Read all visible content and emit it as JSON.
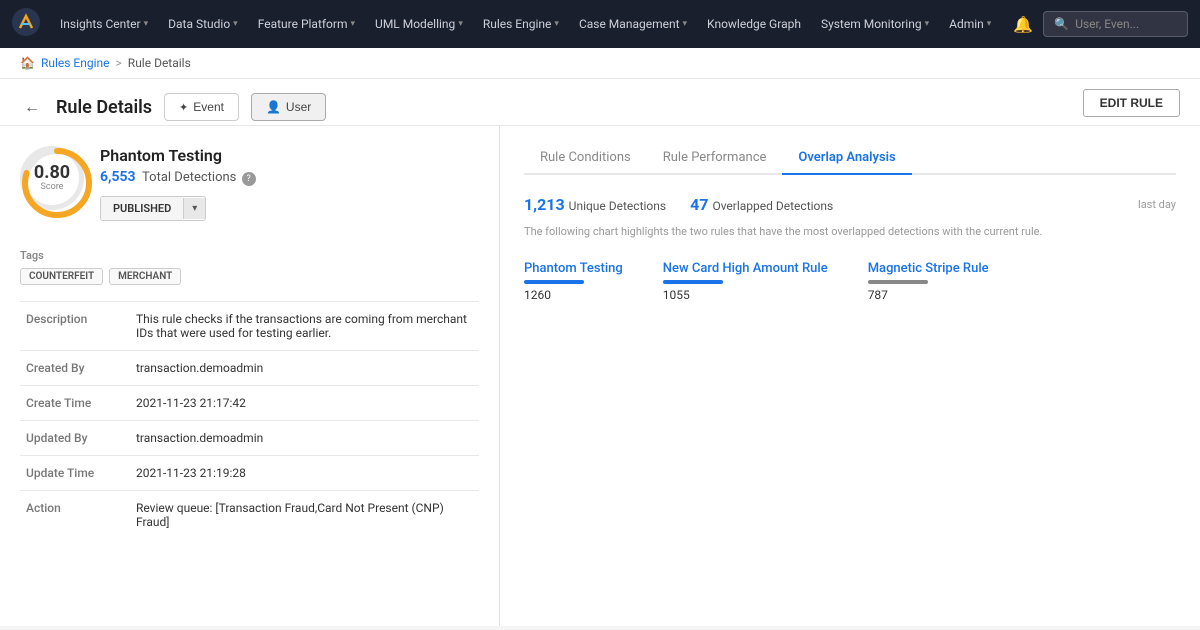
{
  "nav": {
    "items": [
      {
        "label": "Insights Center",
        "has_chevron": true
      },
      {
        "label": "Data Studio",
        "has_chevron": true
      },
      {
        "label": "Feature Platform",
        "has_chevron": true
      },
      {
        "label": "UML Modelling",
        "has_chevron": true
      },
      {
        "label": "Rules Engine",
        "has_chevron": true
      },
      {
        "label": "Case Management",
        "has_chevron": true
      },
      {
        "label": "Knowledge Graph",
        "has_chevron": false
      },
      {
        "label": "System Monitoring",
        "has_chevron": true
      },
      {
        "label": "Admin",
        "has_chevron": true
      }
    ],
    "search_placeholder": "User, Even..."
  },
  "breadcrumb": {
    "home_icon": "🏠",
    "parent_link": "Rules Engine",
    "separator": ">",
    "current": "Rule Details"
  },
  "page_header": {
    "back_icon": "←",
    "title": "Rule Details",
    "tabs": [
      {
        "label": "Event",
        "icon": "✦",
        "active": false
      },
      {
        "label": "User",
        "icon": "👤",
        "active": true
      }
    ],
    "edit_button": "EDIT RULE"
  },
  "left_panel": {
    "score": {
      "value": "0.80",
      "label": "Score",
      "arc_color": "#f5a623",
      "bg_color": "#e8e8e8"
    },
    "rule_name": "Phantom Testing",
    "detections_count": "6,553",
    "detections_label": "Total Detections",
    "status": "PUBLISHED",
    "tags_label": "Tags",
    "tags": [
      "COUNTERFEIT",
      "MERCHANT"
    ],
    "details": [
      {
        "key": "Description",
        "value": "This rule checks if the transactions are coming from merchant IDs that were used for testing earlier."
      },
      {
        "key": "Created By",
        "value": "transaction.demoadmin"
      },
      {
        "key": "Create Time",
        "value": "2021-11-23 21:17:42"
      },
      {
        "key": "Updated By",
        "value": "transaction.demoadmin"
      },
      {
        "key": "Update Time",
        "value": "2021-11-23 21:19:28"
      },
      {
        "key": "Action",
        "value": "Review queue: [Transaction Fraud,Card Not Present (CNP) Fraud]"
      }
    ]
  },
  "right_panel": {
    "tabs": [
      {
        "label": "Rule Conditions",
        "active": false
      },
      {
        "label": "Rule Performance",
        "active": false
      },
      {
        "label": "Overlap Analysis",
        "active": true
      }
    ],
    "unique_detections": "1,213",
    "unique_label": "Unique Detections",
    "overlapped_count": "47",
    "overlapped_label": "Overlapped Detections",
    "time_filter": "last day",
    "chart_description": "The following chart highlights the two rules that have the most overlapped detections with the current rule.",
    "overlap_rules": [
      {
        "name": "Phantom Testing",
        "count": "1260",
        "color": "#1a73e8"
      },
      {
        "name": "New Card High Amount Rule",
        "count": "1055",
        "color": "#1a73e8"
      },
      {
        "name": "Magnetic Stripe Rule",
        "count": "787",
        "color": "#888"
      }
    ]
  }
}
